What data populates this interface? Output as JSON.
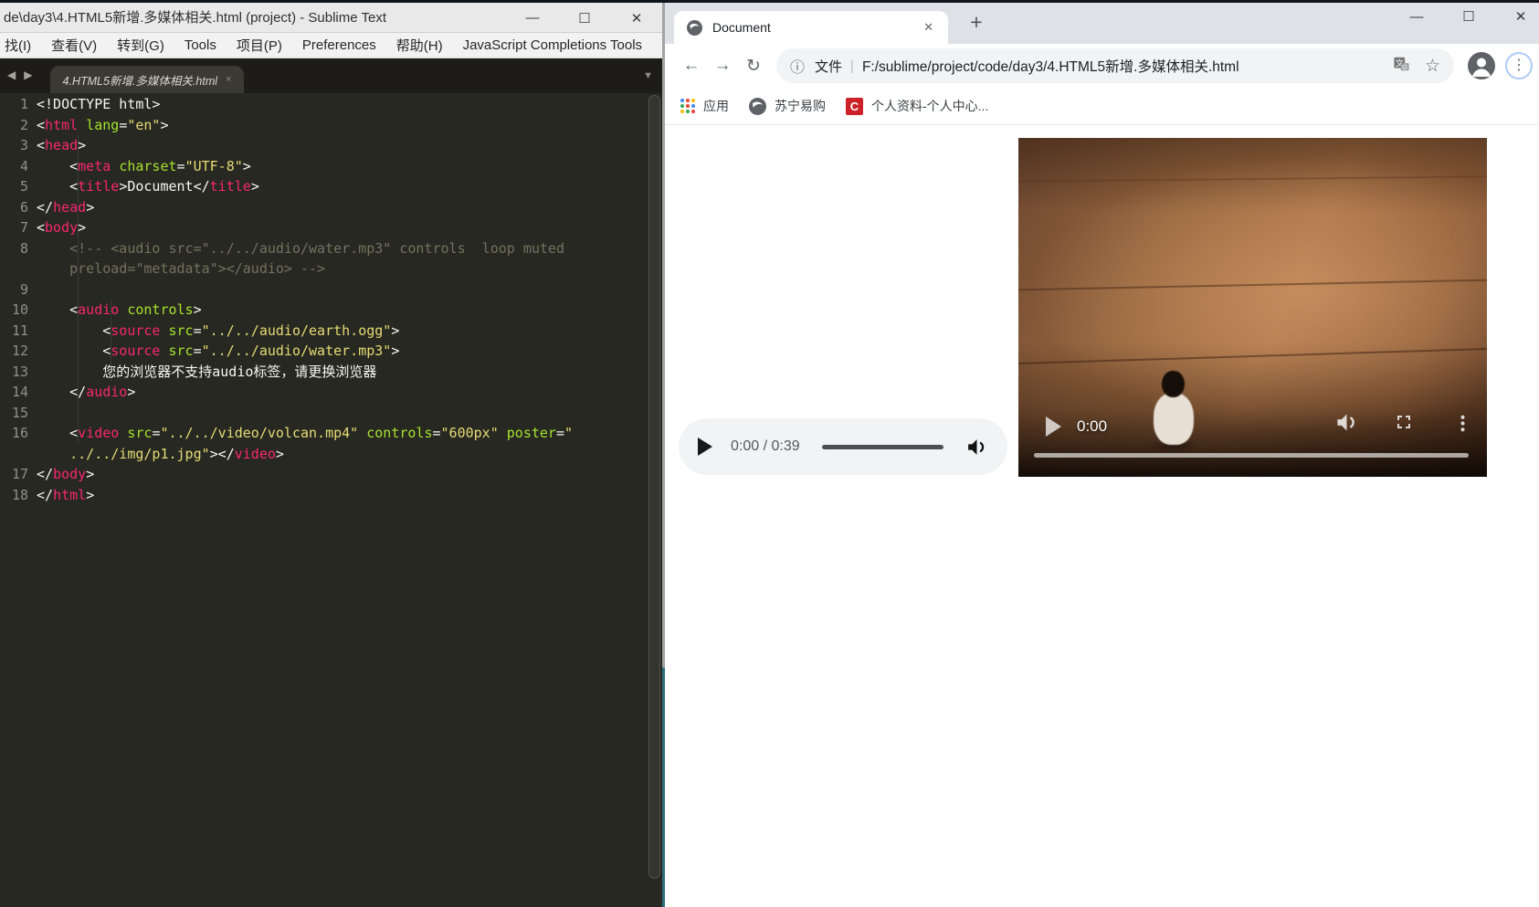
{
  "colors": {
    "monokai_bg": "#272822",
    "monokai_tag": "#f92672",
    "monokai_attr": "#a6e22e",
    "monokai_string": "#e6db74",
    "monokai_comment": "#75715e",
    "monokai_text": "#f8f8f2",
    "chrome_tabstrip": "#dee1e6",
    "chrome_pill": "#f1f3f4",
    "menu_ring_blue": "#aecbfa",
    "bookmark_badge_red": "#cc2128",
    "sublime_border_teal": "#2e6f7e"
  },
  "icons": {
    "minimize": "—",
    "maximize": "☐",
    "close": "✕",
    "tab_close": "×",
    "nav_back_glyph": "◀",
    "nav_fwd_glyph": "▶",
    "tab_overflow": "▼",
    "back": "←",
    "forward": "→",
    "reload": "↻",
    "info": "ⓘ",
    "star": "☆",
    "menu_dots": "⋮",
    "new_tab": "+",
    "divider": "|"
  },
  "sublime": {
    "title": "de\\day3\\4.HTML5新增.多媒体相关.html (project) - Sublime Text",
    "menu_items": [
      "找(I)",
      "查看(V)",
      "转到(G)",
      "Tools",
      "项目(P)",
      "Preferences",
      "帮助(H)",
      "JavaScript Completions Tools"
    ],
    "tab": {
      "label": "4.HTML5新增.多媒体相关.html"
    },
    "code": {
      "rows": [
        {
          "n": "1",
          "s": [
            [
              "w",
              "<!DOCTYPE html>"
            ]
          ]
        },
        {
          "n": "2",
          "s": [
            [
              "w",
              "<"
            ],
            [
              "p",
              "html"
            ],
            [
              "w",
              " "
            ],
            [
              "g",
              "lang"
            ],
            [
              "w",
              "="
            ],
            [
              "y",
              "\"en\""
            ],
            [
              "w",
              ">"
            ]
          ]
        },
        {
          "n": "3",
          "s": [
            [
              "w",
              "<"
            ],
            [
              "p",
              "head"
            ],
            [
              "w",
              ">"
            ]
          ]
        },
        {
          "n": "4",
          "s": [
            [
              "w",
              "    <"
            ],
            [
              "p",
              "meta"
            ],
            [
              "w",
              " "
            ],
            [
              "g",
              "charset"
            ],
            [
              "w",
              "="
            ],
            [
              "y",
              "\"UTF-8\""
            ],
            [
              "w",
              ">"
            ]
          ]
        },
        {
          "n": "5",
          "s": [
            [
              "w",
              "    <"
            ],
            [
              "p",
              "title"
            ],
            [
              "w",
              ">Document</"
            ],
            [
              "p",
              "title"
            ],
            [
              "w",
              ">"
            ]
          ]
        },
        {
          "n": "6",
          "s": [
            [
              "w",
              "</"
            ],
            [
              "p",
              "head"
            ],
            [
              "w",
              ">"
            ]
          ]
        },
        {
          "n": "7",
          "s": [
            [
              "w",
              "<"
            ],
            [
              "p",
              "body"
            ],
            [
              "w",
              ">"
            ]
          ]
        },
        {
          "n": "8",
          "s": [
            [
              "c",
              "    <!-- <audio src=\"../../audio/water.mp3\" controls  loop muted"
            ]
          ]
        },
        {
          "n": "",
          "s": [
            [
              "c",
              "    preload=\"metadata\"></audio> -->"
            ]
          ]
        },
        {
          "n": "9",
          "s": []
        },
        {
          "n": "10",
          "s": [
            [
              "w",
              "    <"
            ],
            [
              "p",
              "audio"
            ],
            [
              "w",
              " "
            ],
            [
              "g",
              "controls"
            ],
            [
              "w",
              ">"
            ]
          ]
        },
        {
          "n": "11",
          "s": [
            [
              "w",
              "        <"
            ],
            [
              "p",
              "source"
            ],
            [
              "w",
              " "
            ],
            [
              "g",
              "src"
            ],
            [
              "w",
              "="
            ],
            [
              "y",
              "\"../../audio/earth.ogg\""
            ],
            [
              "w",
              ">"
            ]
          ]
        },
        {
          "n": "12",
          "s": [
            [
              "w",
              "        <"
            ],
            [
              "p",
              "source"
            ],
            [
              "w",
              " "
            ],
            [
              "g",
              "src"
            ],
            [
              "w",
              "="
            ],
            [
              "y",
              "\"../../audio/water.mp3\""
            ],
            [
              "w",
              ">"
            ]
          ]
        },
        {
          "n": "13",
          "s": [
            [
              "w",
              "        您的浏览器不支持audio标签，请更换浏览器"
            ]
          ]
        },
        {
          "n": "14",
          "s": [
            [
              "w",
              "    </"
            ],
            [
              "p",
              "audio"
            ],
            [
              "w",
              ">"
            ]
          ]
        },
        {
          "n": "15",
          "s": []
        },
        {
          "n": "16",
          "s": [
            [
              "w",
              "    <"
            ],
            [
              "p",
              "video"
            ],
            [
              "w",
              " "
            ],
            [
              "g",
              "src"
            ],
            [
              "w",
              "="
            ],
            [
              "y",
              "\"../../video/volcan.mp4\""
            ],
            [
              "w",
              " "
            ],
            [
              "g",
              "controls"
            ],
            [
              "w",
              "="
            ],
            [
              "y",
              "\"600px\""
            ],
            [
              "w",
              " "
            ],
            [
              "g",
              "poster"
            ],
            [
              "w",
              "="
            ],
            [
              "y",
              "\""
            ]
          ]
        },
        {
          "n": "",
          "s": [
            [
              "w",
              "    "
            ],
            [
              "y",
              "../../img/p1.jpg\""
            ],
            [
              "w",
              "></"
            ],
            [
              "p",
              "video"
            ],
            [
              "w",
              ">"
            ]
          ]
        },
        {
          "n": "17",
          "s": [
            [
              "w",
              "</"
            ],
            [
              "p",
              "body"
            ],
            [
              "w",
              ">"
            ]
          ]
        },
        {
          "n": "18",
          "s": [
            [
              "w",
              "</"
            ],
            [
              "p",
              "html"
            ],
            [
              "w",
              ">"
            ]
          ]
        }
      ]
    }
  },
  "chrome": {
    "tab": {
      "title": "Document"
    },
    "address": {
      "prefix": "文件",
      "url": "F:/sublime/project/code/day3/4.HTML5新增.多媒体相关.html"
    },
    "bookmarks": [
      "应用",
      "苏宁易购",
      "个人资料-个人中心..."
    ],
    "badge_c": "C",
    "page": {
      "audio": {
        "time": "0:00 / 0:39"
      },
      "video": {
        "time": "0:00"
      }
    }
  }
}
